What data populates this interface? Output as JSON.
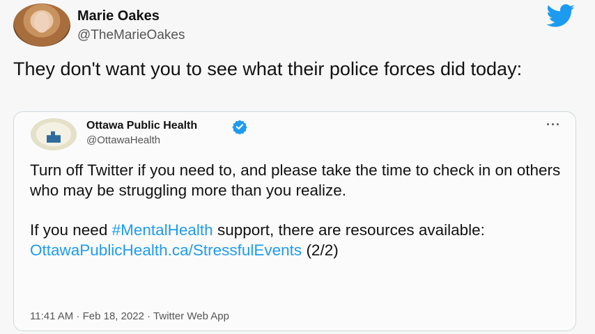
{
  "tweet": {
    "author_name": "Marie Oakes",
    "author_handle": "@TheMarieOakes",
    "text": "They don't want you to see what their police forces did today:",
    "logo_icon": "twitter-bird-icon"
  },
  "quoted_tweet": {
    "author_name": "Ottawa Public Health",
    "author_handle": "@OttawaHealth",
    "verified_icon": "verified-badge-icon",
    "more_icon": "more-options-icon",
    "more_label": "···",
    "paragraph1": "Turn off Twitter if you need to, and please take the time to check in on others who may be struggling more than you realize.",
    "p2_before": "If you need ",
    "hashtag": "#MentalHealth",
    "p2_after": " support, there are resources available: ",
    "link": "OttawaPublicHealth.ca/StressfulEvents",
    "p2_suffix": " (2/2)",
    "meta": "11:41 AM · Feb 18, 2022 · Twitter Web App"
  },
  "colors": {
    "accent": "#1d9bf0",
    "text": "#111111",
    "secondary": "#555555",
    "border": "#cfd9de"
  }
}
